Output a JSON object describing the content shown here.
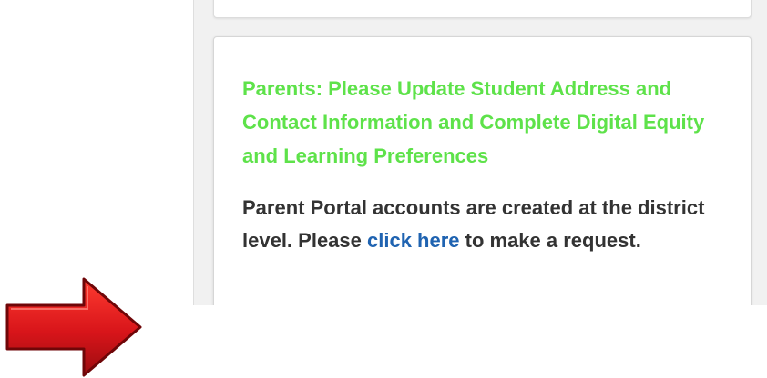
{
  "notice": {
    "heading": "Parents: Please Update Student Address and Contact Information and Complete Digital Equity and Learning Preferences",
    "body_before": "Parent Portal accounts are created at the district level. Please ",
    "link_text": "click here",
    "body_after": " to make a request."
  },
  "colors": {
    "heading": "#5ee24a",
    "link": "#1f63b1",
    "body_text": "#333333",
    "arrow": "#d8151a"
  },
  "overlay": {
    "arrow_icon": "right-arrow-icon"
  }
}
